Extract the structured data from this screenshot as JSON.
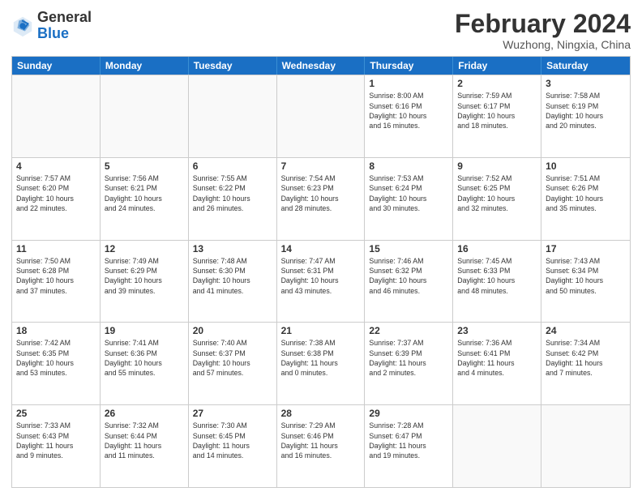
{
  "header": {
    "logo_general": "General",
    "logo_blue": "Blue",
    "title": "February 2024",
    "subtitle": "Wuzhong, Ningxia, China"
  },
  "days": [
    "Sunday",
    "Monday",
    "Tuesday",
    "Wednesday",
    "Thursday",
    "Friday",
    "Saturday"
  ],
  "rows": [
    [
      {
        "day": "",
        "info": ""
      },
      {
        "day": "",
        "info": ""
      },
      {
        "day": "",
        "info": ""
      },
      {
        "day": "",
        "info": ""
      },
      {
        "day": "1",
        "info": "Sunrise: 8:00 AM\nSunset: 6:16 PM\nDaylight: 10 hours\nand 16 minutes."
      },
      {
        "day": "2",
        "info": "Sunrise: 7:59 AM\nSunset: 6:17 PM\nDaylight: 10 hours\nand 18 minutes."
      },
      {
        "day": "3",
        "info": "Sunrise: 7:58 AM\nSunset: 6:19 PM\nDaylight: 10 hours\nand 20 minutes."
      }
    ],
    [
      {
        "day": "4",
        "info": "Sunrise: 7:57 AM\nSunset: 6:20 PM\nDaylight: 10 hours\nand 22 minutes."
      },
      {
        "day": "5",
        "info": "Sunrise: 7:56 AM\nSunset: 6:21 PM\nDaylight: 10 hours\nand 24 minutes."
      },
      {
        "day": "6",
        "info": "Sunrise: 7:55 AM\nSunset: 6:22 PM\nDaylight: 10 hours\nand 26 minutes."
      },
      {
        "day": "7",
        "info": "Sunrise: 7:54 AM\nSunset: 6:23 PM\nDaylight: 10 hours\nand 28 minutes."
      },
      {
        "day": "8",
        "info": "Sunrise: 7:53 AM\nSunset: 6:24 PM\nDaylight: 10 hours\nand 30 minutes."
      },
      {
        "day": "9",
        "info": "Sunrise: 7:52 AM\nSunset: 6:25 PM\nDaylight: 10 hours\nand 32 minutes."
      },
      {
        "day": "10",
        "info": "Sunrise: 7:51 AM\nSunset: 6:26 PM\nDaylight: 10 hours\nand 35 minutes."
      }
    ],
    [
      {
        "day": "11",
        "info": "Sunrise: 7:50 AM\nSunset: 6:28 PM\nDaylight: 10 hours\nand 37 minutes."
      },
      {
        "day": "12",
        "info": "Sunrise: 7:49 AM\nSunset: 6:29 PM\nDaylight: 10 hours\nand 39 minutes."
      },
      {
        "day": "13",
        "info": "Sunrise: 7:48 AM\nSunset: 6:30 PM\nDaylight: 10 hours\nand 41 minutes."
      },
      {
        "day": "14",
        "info": "Sunrise: 7:47 AM\nSunset: 6:31 PM\nDaylight: 10 hours\nand 43 minutes."
      },
      {
        "day": "15",
        "info": "Sunrise: 7:46 AM\nSunset: 6:32 PM\nDaylight: 10 hours\nand 46 minutes."
      },
      {
        "day": "16",
        "info": "Sunrise: 7:45 AM\nSunset: 6:33 PM\nDaylight: 10 hours\nand 48 minutes."
      },
      {
        "day": "17",
        "info": "Sunrise: 7:43 AM\nSunset: 6:34 PM\nDaylight: 10 hours\nand 50 minutes."
      }
    ],
    [
      {
        "day": "18",
        "info": "Sunrise: 7:42 AM\nSunset: 6:35 PM\nDaylight: 10 hours\nand 53 minutes."
      },
      {
        "day": "19",
        "info": "Sunrise: 7:41 AM\nSunset: 6:36 PM\nDaylight: 10 hours\nand 55 minutes."
      },
      {
        "day": "20",
        "info": "Sunrise: 7:40 AM\nSunset: 6:37 PM\nDaylight: 10 hours\nand 57 minutes."
      },
      {
        "day": "21",
        "info": "Sunrise: 7:38 AM\nSunset: 6:38 PM\nDaylight: 11 hours\nand 0 minutes."
      },
      {
        "day": "22",
        "info": "Sunrise: 7:37 AM\nSunset: 6:39 PM\nDaylight: 11 hours\nand 2 minutes."
      },
      {
        "day": "23",
        "info": "Sunrise: 7:36 AM\nSunset: 6:41 PM\nDaylight: 11 hours\nand 4 minutes."
      },
      {
        "day": "24",
        "info": "Sunrise: 7:34 AM\nSunset: 6:42 PM\nDaylight: 11 hours\nand 7 minutes."
      }
    ],
    [
      {
        "day": "25",
        "info": "Sunrise: 7:33 AM\nSunset: 6:43 PM\nDaylight: 11 hours\nand 9 minutes."
      },
      {
        "day": "26",
        "info": "Sunrise: 7:32 AM\nSunset: 6:44 PM\nDaylight: 11 hours\nand 11 minutes."
      },
      {
        "day": "27",
        "info": "Sunrise: 7:30 AM\nSunset: 6:45 PM\nDaylight: 11 hours\nand 14 minutes."
      },
      {
        "day": "28",
        "info": "Sunrise: 7:29 AM\nSunset: 6:46 PM\nDaylight: 11 hours\nand 16 minutes."
      },
      {
        "day": "29",
        "info": "Sunrise: 7:28 AM\nSunset: 6:47 PM\nDaylight: 11 hours\nand 19 minutes."
      },
      {
        "day": "",
        "info": ""
      },
      {
        "day": "",
        "info": ""
      }
    ]
  ]
}
